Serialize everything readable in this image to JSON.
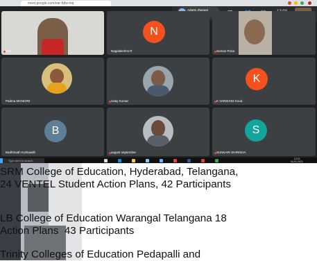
{
  "browser": {
    "url": "meet.google.com/ear-fqfw-mq"
  },
  "meeting": {
    "presenter_chip": "Adarts Jharwal\nand 2w more",
    "clock": "12:03"
  },
  "participants": [
    {
      "name": "You",
      "kind": "photo",
      "color": "#7a5e48"
    },
    {
      "name": "Nagalakshmi R",
      "kind": "letter",
      "letter": "N",
      "color": "#f4511e"
    },
    {
      "name": "Suman Poria",
      "kind": "photo",
      "color": "#8a7a66"
    },
    {
      "name": "Padma MGNCRE",
      "kind": "photo",
      "color": "#c49a3c"
    },
    {
      "name": "Uday Kumar",
      "kind": "photo",
      "color": "#6b7480"
    },
    {
      "name": "K VARSHINI Goud",
      "kind": "letter",
      "letter": "K",
      "color": "#f4511e"
    },
    {
      "name": "Badhrinath Kothawdh",
      "kind": "letter",
      "letter": "B",
      "color": "#5f7f99"
    },
    {
      "name": "august september",
      "kind": "photo",
      "color": "#606a72"
    },
    {
      "name": "SUNKARI SHIRISHA",
      "kind": "letter",
      "letter": "S",
      "color": "#12a59b"
    }
  ],
  "taskbar": {
    "search_label": "Type here to search",
    "time": "12:03",
    "date": "04-01-2021"
  },
  "caption": {
    "line1": "SRM College of Education, Hyderabad, Telangana,",
    "line2": "24 VENTEL Student Action Plans, 42 Participants",
    "line3": "LB College of Education Warangal Telangana 18",
    "line4": "Action Plans  43 Participants",
    "line5": "Trinity Colleges of Education Pedapalli and"
  }
}
